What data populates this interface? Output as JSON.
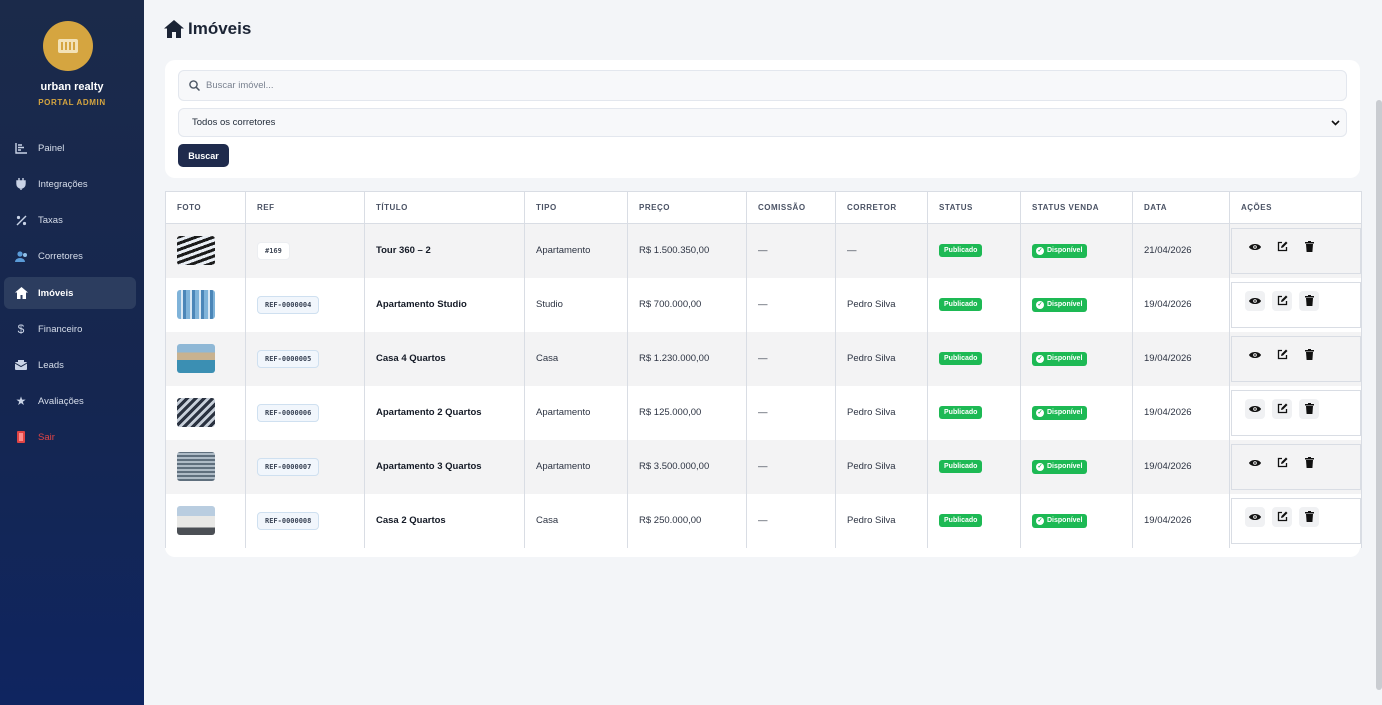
{
  "brand": {
    "name": "urban realty",
    "subtitle": "PORTAL ADMIN"
  },
  "sidebar": {
    "items": [
      {
        "label": "Painel",
        "icon": "chart-icon"
      },
      {
        "label": "Integrações",
        "icon": "plug-icon"
      },
      {
        "label": "Taxas",
        "icon": "percent-icon"
      },
      {
        "label": "Corretores",
        "icon": "users-icon"
      },
      {
        "label": "Imóveis",
        "icon": "home-icon",
        "active": true
      },
      {
        "label": "Financeiro",
        "icon": "dollar-icon"
      },
      {
        "label": "Leads",
        "icon": "inbox-icon"
      },
      {
        "label": "Avaliações",
        "icon": "star-icon"
      },
      {
        "label": "Sair",
        "icon": "logout-icon"
      }
    ]
  },
  "page": {
    "title": "Imóveis"
  },
  "filters": {
    "search_placeholder": "Buscar imóvel...",
    "broker_select": "Todos os corretores",
    "search_button": "Buscar"
  },
  "table": {
    "columns": [
      "FOTO",
      "REF",
      "TÍTULO",
      "TIPO",
      "PREÇO",
      "COMISSÃO",
      "CORRETOR",
      "STATUS",
      "STATUS VENDA",
      "DATA",
      "AÇÕES"
    ],
    "rows": [
      {
        "ref": "#169",
        "title": "Tour 360 – 2",
        "type": "Apartamento",
        "price": "R$ 1.500.350,00",
        "commission": "—",
        "broker": "—",
        "status": "Publicado",
        "sale_status": "Disponível",
        "date": "21/04/2026"
      },
      {
        "ref": "REF-0000004",
        "title": "Apartamento Studio",
        "type": "Studio",
        "price": "R$ 700.000,00",
        "commission": "—",
        "broker": "Pedro Silva",
        "status": "Publicado",
        "sale_status": "Disponível",
        "date": "19/04/2026"
      },
      {
        "ref": "REF-0000005",
        "title": "Casa 4 Quartos",
        "type": "Casa",
        "price": "R$ 1.230.000,00",
        "commission": "—",
        "broker": "Pedro Silva",
        "status": "Publicado",
        "sale_status": "Disponível",
        "date": "19/04/2026"
      },
      {
        "ref": "REF-0000006",
        "title": "Apartamento 2 Quartos",
        "type": "Apartamento",
        "price": "R$ 125.000,00",
        "commission": "—",
        "broker": "Pedro Silva",
        "status": "Publicado",
        "sale_status": "Disponível",
        "date": "19/04/2026"
      },
      {
        "ref": "REF-0000007",
        "title": "Apartamento 3 Quartos",
        "type": "Apartamento",
        "price": "R$ 3.500.000,00",
        "commission": "—",
        "broker": "Pedro Silva",
        "status": "Publicado",
        "sale_status": "Disponível",
        "date": "19/04/2026"
      },
      {
        "ref": "REF-0000008",
        "title": "Casa 2 Quartos",
        "type": "Casa",
        "price": "R$ 250.000,00",
        "commission": "—",
        "broker": "Pedro Silva",
        "status": "Publicado",
        "sale_status": "Disponível",
        "date": "19/04/2026"
      }
    ]
  },
  "colors": {
    "sidebar": "#1b2a4a",
    "accent": "#d5a540",
    "success": "#1db954",
    "button": "#1f2b4d",
    "danger": "#e04444"
  }
}
